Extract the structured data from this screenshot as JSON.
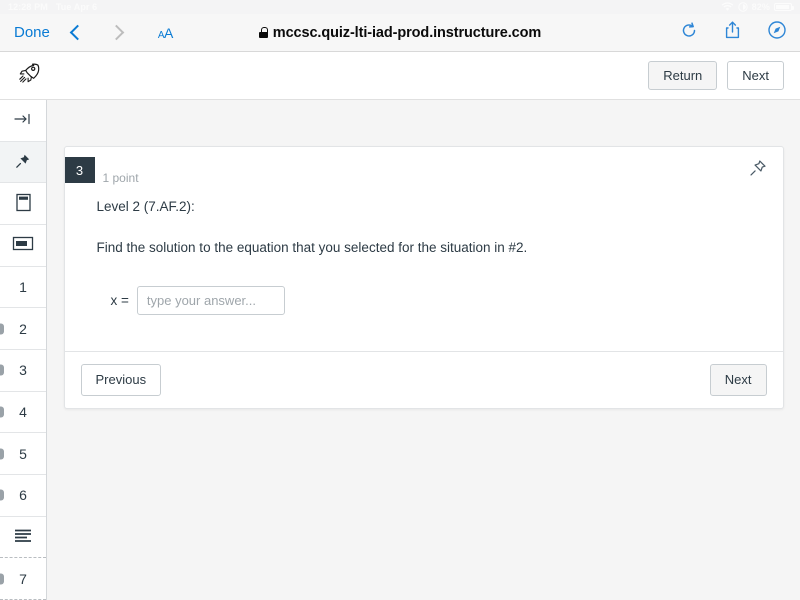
{
  "status_bar": {
    "time": "12:28 PM",
    "date": "Tue Apr 6",
    "battery_percent": "82%",
    "wifi_icon": "wifi-icon",
    "lock_rotation_icon": "rotation-lock-icon",
    "battery_icon": "battery-icon"
  },
  "browser": {
    "done_label": "Done",
    "back_icon": "chevron-left-icon",
    "forward_icon": "chevron-right-icon",
    "text_size_label": "AA",
    "url": "mccsc.quiz-lti-iad-prod.instructure.com",
    "lock_icon": "lock-icon",
    "reload_icon": "reload-icon",
    "share_icon": "share-icon",
    "safari_icon": "compass-icon"
  },
  "app_toolbar": {
    "rocket_icon": "rocket-icon",
    "return_label": "Return",
    "next_label": "Next"
  },
  "sidebar": {
    "items": [
      {
        "type": "icon",
        "icon": "collapse-arrow-icon",
        "label": "",
        "selected": false,
        "marker": false
      },
      {
        "type": "icon",
        "icon": "pin-icon",
        "label": "",
        "selected": true,
        "marker": false
      },
      {
        "type": "icon",
        "icon": "note-icon",
        "label": "",
        "selected": false,
        "marker": false
      },
      {
        "type": "icon",
        "icon": "flag-card-icon",
        "label": "",
        "selected": false,
        "marker": false
      },
      {
        "type": "number",
        "icon": "",
        "label": "1",
        "selected": false,
        "marker": false
      },
      {
        "type": "number",
        "icon": "",
        "label": "2",
        "selected": false,
        "marker": true
      },
      {
        "type": "number",
        "icon": "",
        "label": "3",
        "selected": false,
        "marker": true
      },
      {
        "type": "number",
        "icon": "",
        "label": "4",
        "selected": false,
        "marker": true
      },
      {
        "type": "number",
        "icon": "",
        "label": "5",
        "selected": false,
        "marker": true
      },
      {
        "type": "number",
        "icon": "",
        "label": "6",
        "selected": false,
        "marker": true
      },
      {
        "type": "icon",
        "icon": "list-lines-icon",
        "label": "",
        "selected": false,
        "marker": false
      },
      {
        "type": "number",
        "icon": "",
        "label": "7",
        "selected": false,
        "marker": true
      }
    ]
  },
  "question": {
    "number": "3",
    "points": "1 point",
    "pin_icon": "pin-icon",
    "level": "Level 2 (7.AF.2):",
    "prompt": "Find the solution to the equation that you selected for the situation in #2.",
    "answer_label": "x =",
    "answer_value": "",
    "answer_placeholder": "type your answer...",
    "previous_label": "Previous",
    "next_label": "Next"
  },
  "colors": {
    "accent_blue": "#0a7bd4",
    "badge_dark": "#2d3b45",
    "page_background": "#f5f5f5",
    "border": "#c7cdd1"
  }
}
